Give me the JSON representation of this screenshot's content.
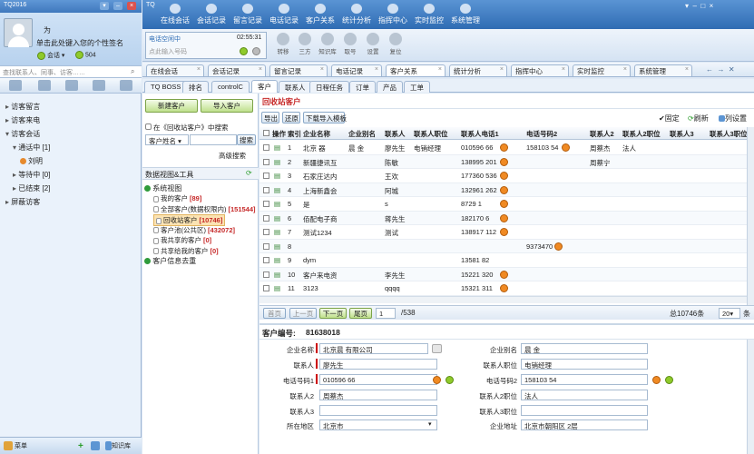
{
  "app": {
    "title": "TQ2016",
    "right_title": "TQ"
  },
  "left": {
    "nickname": "为",
    "signature": "单击此处键入您的个性签名",
    "status": "会话",
    "count": "504",
    "search_placeholder": "查找联系人、同事、访客……",
    "tree": [
      {
        "label": "访客留言",
        "level": 0,
        "arrow": "▸"
      },
      {
        "label": "访客来电",
        "level": 0,
        "arrow": "▸"
      },
      {
        "label": "访客会话",
        "level": 0,
        "arrow": "▾"
      },
      {
        "label": "通话中 [1]",
        "level": 1,
        "arrow": "▾"
      },
      {
        "label": "刘明",
        "level": 2,
        "arrow": ""
      },
      {
        "label": "等待中 [0]",
        "level": 1,
        "arrow": "▸"
      },
      {
        "label": "已结束 [2]",
        "level": 1,
        "arrow": "▸"
      },
      {
        "label": "屏蔽访客",
        "level": 0,
        "arrow": "▸"
      }
    ],
    "menu_label": "菜单",
    "kb_label": "知识库"
  },
  "topnav": [
    "在线会话",
    "会话记录",
    "留言记录",
    "电话记录",
    "客户关系",
    "统计分析",
    "指挥中心",
    "实时监控",
    "系统管理"
  ],
  "phone": {
    "status": "电话空闲中",
    "time": "02:55:31",
    "placeholder": "点此输入号码"
  },
  "tools": [
    "转移",
    "三方",
    "知识库",
    "取号",
    "设置",
    "复位"
  ],
  "window_tabs": [
    "在线会话",
    "会话记录",
    "留言记录",
    "电话记录",
    "客户关系",
    "统计分析",
    "指挥中心",
    "实时监控",
    "系统管理"
  ],
  "crm_tabs": [
    "TQ BOSS",
    "排名",
    "controlC",
    "客户",
    "联系人",
    "日程任务",
    "订单",
    "产品",
    "工单"
  ],
  "side": {
    "new_btn": "新建客户",
    "import_btn": "导入客户",
    "search_in_label": "在《回收站客户》中搜索",
    "search_field": "客户姓名",
    "search_btn": "搜索",
    "adv_search": "高级搜索",
    "views_title": "数据视图&工具",
    "system_views": "系统视图",
    "views": [
      {
        "name": "我的客户",
        "count": "[89]"
      },
      {
        "name": "全部客户(数据权限内)",
        "count": "[151544]"
      },
      {
        "name": "回收站客户",
        "count": "[10746]"
      },
      {
        "name": "客户池(公共区)",
        "count": "[432072]"
      },
      {
        "name": "我共享的客户",
        "count": "[0]"
      },
      {
        "name": "共享给我的客户",
        "count": "[0]"
      }
    ],
    "info_dup": "客户信息去重"
  },
  "main": {
    "title": "回收站客户",
    "tb_export": "导出",
    "tb_restore": "还原",
    "tb_template": "下载导入模板",
    "tb_fix": "固定",
    "tb_refresh": "刷新",
    "tb_columns": "列设置",
    "columns": [
      "操作",
      "索引",
      "企业名称",
      "企业别名",
      "联系人",
      "联系人职位",
      "联系人电话1",
      "电话号码2",
      "联系人2",
      "联系人2职位",
      "联系人3",
      "联系人3职位"
    ],
    "rows": [
      {
        "idx": "1",
        "name": "北京   器",
        "alias": "晨   金",
        "contact": "廖先生",
        "title": "电销经理",
        "p1": "010596   66",
        "p2": "158103   54",
        "c2": "周蔡杰",
        "c2t": "法人",
        "ok1": true,
        "ok2": true
      },
      {
        "idx": "2",
        "name": "新疆捷讯互",
        "alias": "",
        "contact": "陈敏",
        "title": "",
        "p1": "138995   201",
        "p2": "",
        "c2": "周蔡宁",
        "c2t": "",
        "ok1": true,
        "ok2": false
      },
      {
        "idx": "3",
        "name": "石家庄达内",
        "alias": "",
        "contact": "王欢",
        "title": "",
        "p1": "177360   536",
        "p2": "",
        "c2": "",
        "c2t": "",
        "ok1": true,
        "ok2": false
      },
      {
        "idx": "4",
        "name": "上海新鑫会",
        "alias": "",
        "contact": "阿城",
        "title": "",
        "p1": "132961   262",
        "p2": "",
        "c2": "",
        "c2t": "",
        "ok1": true,
        "ok2": false
      },
      {
        "idx": "5",
        "name": "是",
        "alias": "",
        "contact": "s",
        "title": "",
        "p1": "8729   1",
        "p2": "",
        "c2": "",
        "c2t": "",
        "ok1": true,
        "ok2": false
      },
      {
        "idx": "6",
        "name": "佰配电子商",
        "alias": "",
        "contact": "蒋先生",
        "title": "",
        "p1": "182170   6",
        "p2": "",
        "c2": "",
        "c2t": "",
        "ok1": true,
        "ok2": false
      },
      {
        "idx": "7",
        "name": "测试1234",
        "alias": "",
        "contact": "测试",
        "title": "",
        "p1": "138917   112",
        "p2": "",
        "c2": "",
        "c2t": "",
        "ok1": true,
        "ok2": false
      },
      {
        "idx": "8",
        "name": "",
        "alias": "",
        "contact": "",
        "title": "",
        "p1": "",
        "p2": "9373470",
        "c2": "",
        "c2t": "",
        "ok1": false,
        "ok2": true
      },
      {
        "idx": "9",
        "name": "dym",
        "alias": "",
        "contact": "",
        "title": "",
        "p1": "13581   82",
        "p2": "",
        "c2": "",
        "c2t": "",
        "ok1": false,
        "ok2": false
      },
      {
        "idx": "10",
        "name": "客户来电资",
        "alias": "",
        "contact": "李先生",
        "title": "",
        "p1": "15221   320",
        "p2": "",
        "c2": "",
        "c2t": "",
        "ok1": true,
        "ok2": false
      },
      {
        "idx": "11",
        "name": "3123",
        "alias": "",
        "contact": "qqqq",
        "title": "",
        "p1": "15321   311",
        "p2": "",
        "c2": "",
        "c2t": "",
        "ok1": true,
        "ok2": false
      }
    ],
    "pager": {
      "first": "首页",
      "prev": "上一页",
      "next": "下一页",
      "last": "尾页",
      "page": "1",
      "total_pages": "/538",
      "summary": "总10746条",
      "per_page": "20",
      "unit": "条"
    }
  },
  "detail": {
    "code_label": "客户编号:",
    "code": "81638018",
    "fields_left": [
      {
        "label": "企业名称",
        "value": "北京晨   有限公司",
        "req": true
      },
      {
        "label": "联系人",
        "value": "廖先生",
        "req": true
      },
      {
        "label": "电话号码1",
        "value": "010596   66",
        "req": true
      },
      {
        "label": "联系人2",
        "value": "周蔡杰",
        "req": false
      },
      {
        "label": "联系人3",
        "value": "",
        "req": false
      },
      {
        "label": "所在地区",
        "value": "北京市",
        "req": false
      }
    ],
    "fields_right": [
      {
        "label": "企业别名",
        "value": "晨   金"
      },
      {
        "label": "联系人职位",
        "value": "电销经理"
      },
      {
        "label": "电话号码2",
        "value": "158103   54"
      },
      {
        "label": "联系人2职位",
        "value": "法人"
      },
      {
        "label": "联系人3职位",
        "value": ""
      },
      {
        "label": "企业地址",
        "value": "北京市朝阳区   2层"
      }
    ]
  }
}
